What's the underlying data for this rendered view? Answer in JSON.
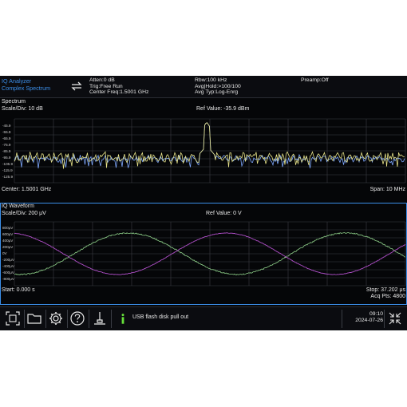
{
  "app": {
    "title": "IQ Analyzer",
    "mode": "Complex Spectrum"
  },
  "header": {
    "atten": "Atten:0 dB",
    "trig": "Trig:Free Run",
    "center_freq": "Center Freq:1.5001 GHz",
    "rbw": "Rbw:100 kHz",
    "avg_hold": "Avg|Hold:>100/100",
    "avg_type": "Avg Typ:Log-Enrg",
    "preamp": "Preamp:Off"
  },
  "spectrum": {
    "title": "Spectrum",
    "scale": "Scale/Div: 10 dB",
    "ref_value": "Ref Value: -35.9 dBm",
    "y_ticks": [
      "-45.9",
      "-55.9",
      "-65.9",
      "-75.9",
      "-85.9",
      "-95.9",
      "-105.9",
      "-115.9",
      "-125.9"
    ],
    "center": "Center: 1.5001 GHz",
    "span": "Span: 10 MHz"
  },
  "waveform": {
    "title": "IQ Waveform",
    "scale": "Scale/Div: 200 μV",
    "ref_value": "Ref Value: 0 V",
    "y_ticks": [
      "800μV",
      "600μV",
      "400μV",
      "200μV",
      "0V",
      "-200μV",
      "-400μV",
      "-600μV",
      "-800μV"
    ],
    "start": "Start: 0.000 s",
    "stop": "Stop: 37.202 μs",
    "acq_pts": "Acq Pts: 4800"
  },
  "status": {
    "message": "USB flash disk pull out",
    "time": "09:10",
    "date": "2024-07-26"
  },
  "colors": {
    "accent": "#3b8ee8",
    "trace_yellow": "#e8e48a",
    "trace_blue": "#7fa9ff",
    "trace_green": "#8fd18a",
    "trace_purple": "#b04fc9",
    "info_green": "#66e03a"
  }
}
